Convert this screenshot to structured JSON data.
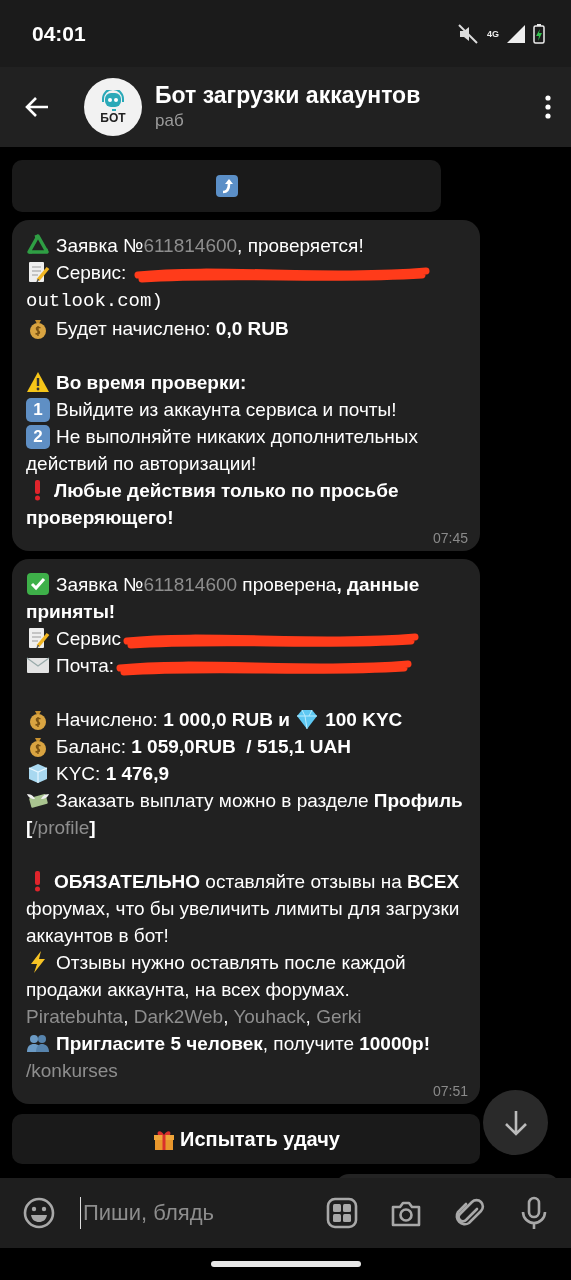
{
  "status_bar": {
    "time": "04:01",
    "network": "4G"
  },
  "header": {
    "title": "Бот загрузки аккаунтов",
    "subtitle": "раб",
    "avatar_label": "БОТ"
  },
  "chat": [
    {
      "kind": "keyboard_button",
      "segments": [
        {
          "kind": "return-arrow"
        }
      ]
    },
    {
      "kind": "message",
      "time": "07:45",
      "blocks": [
        [
          {
            "segments": [
              {
                "kind": "recycle"
              },
              {
                "kind": "text",
                "text": "Заявка №"
              },
              {
                "kind": "link",
                "text": "611814600"
              },
              {
                "kind": "text",
                "text": ", проверяется!"
              }
            ]
          },
          {
            "segments": [
              {
                "kind": "memo"
              },
              {
                "kind": "text",
                "text": "Сервис: "
              },
              {
                "kind": "redaction"
              },
              {
                "kind": "mono",
                "text": "outlook.com)"
              }
            ]
          },
          {
            "segments": [
              {
                "kind": "money-bag"
              },
              {
                "kind": "text",
                "text": "Будет начислено: "
              },
              {
                "kind": "bold",
                "text": "0,0 RUB"
              }
            ]
          }
        ],
        [
          {
            "segments": [
              {
                "kind": "warning"
              },
              {
                "kind": "bold",
                "text": "Во время проверки:"
              }
            ]
          },
          {
            "segments": [
              {
                "kind": "keycap",
                "text": "1"
              },
              {
                "kind": "text",
                "text": "Выйдите из аккаунта сервиса и почты!"
              }
            ]
          },
          {
            "segments": [
              {
                "kind": "keycap",
                "text": "2"
              },
              {
                "kind": "text",
                "text": "Не выполняйте никаких дополнительных действий по авторизации!"
              }
            ]
          },
          {
            "segments": [
              {
                "kind": "exclamation"
              },
              {
                "kind": "bold",
                "text": "Любые действия только по просьбе проверяющего!"
              }
            ]
          }
        ]
      ]
    },
    {
      "kind": "message",
      "time": "07:51",
      "blocks": [
        [
          {
            "segments": [
              {
                "kind": "check"
              },
              {
                "kind": "text",
                "text": "Заявка №"
              },
              {
                "kind": "link",
                "text": "611814600"
              },
              {
                "kind": "text",
                "text": " проверена"
              },
              {
                "kind": "bold",
                "text": ", данные приняты!"
              }
            ]
          },
          {
            "segments": [
              {
                "kind": "memo"
              },
              {
                "kind": "text",
                "text": "Сервис"
              },
              {
                "kind": "redaction"
              }
            ]
          },
          {
            "segments": [
              {
                "kind": "envelope"
              },
              {
                "kind": "text",
                "text": "Почта:"
              },
              {
                "kind": "redaction"
              }
            ]
          }
        ],
        [
          {
            "segments": [
              {
                "kind": "money-bag"
              },
              {
                "kind": "text",
                "text": "Начислено: "
              },
              {
                "kind": "bold",
                "text": "1 000,0 RUB и "
              },
              {
                "kind": "diamond"
              },
              {
                "kind": "bold",
                "text": "100 KYC"
              }
            ]
          },
          {
            "segments": [
              {
                "kind": "money-bag"
              },
              {
                "kind": "text",
                "text": "Баланс: "
              },
              {
                "kind": "bold",
                "text": "1 059,0RUB  / 515,1 UAH"
              }
            ]
          },
          {
            "segments": [
              {
                "kind": "ice"
              },
              {
                "kind": "text",
                "text": "KYC: "
              },
              {
                "kind": "bold",
                "text": "1 476,9"
              }
            ]
          },
          {
            "segments": [
              {
                "kind": "money-wings"
              },
              {
                "kind": "text",
                "text": "Заказать выплату можно в разделе "
              },
              {
                "kind": "bold",
                "text": "Профиль ["
              },
              {
                "kind": "link",
                "text": "/profile"
              },
              {
                "kind": "bold",
                "text": "]"
              }
            ]
          }
        ],
        [
          {
            "segments": [
              {
                "kind": "exclamation"
              },
              {
                "kind": "bold",
                "text": "ОБЯЗАТЕЛЬНО"
              },
              {
                "kind": "text",
                "text": " оставляйте отзывы на "
              },
              {
                "kind": "bold",
                "text": "ВСЕХ"
              },
              {
                "kind": "text",
                "text": " форумах, что бы увеличить лимиты для загрузки аккаунтов в бот!"
              }
            ]
          },
          {
            "segments": [
              {
                "kind": "lightning"
              },
              {
                "kind": "text",
                "text": "Отзывы нужно оставлять после каждой продажи аккаунта, на всех форумах."
              }
            ]
          },
          {
            "segments": [
              {
                "kind": "link",
                "text": "Piratebuhta"
              },
              {
                "kind": "text",
                "text": ", "
              },
              {
                "kind": "link",
                "text": "Dark2Web"
              },
              {
                "kind": "text",
                "text": ", "
              },
              {
                "kind": "link",
                "text": "Youhack"
              },
              {
                "kind": "text",
                "text": ", "
              },
              {
                "kind": "link",
                "text": "Gerki"
              }
            ]
          },
          {
            "segments": [
              {
                "kind": "people"
              },
              {
                "kind": "bold",
                "text": "Пригласите 5 человек"
              },
              {
                "kind": "text",
                "text": ", получите "
              },
              {
                "kind": "bold",
                "text": "10000р!"
              }
            ]
          },
          {
            "segments": [
              {
                "kind": "link",
                "text": "/konkurses"
              }
            ]
          }
        ]
      ]
    },
    {
      "kind": "keyboard_button",
      "segments": [
        {
          "kind": "gift"
        },
        {
          "kind": "bold",
          "text": "Испытать удачу"
        }
      ]
    },
    {
      "kind": "outgoing_stub"
    }
  ],
  "composer": {
    "placeholder": "Пиши, блядь"
  }
}
